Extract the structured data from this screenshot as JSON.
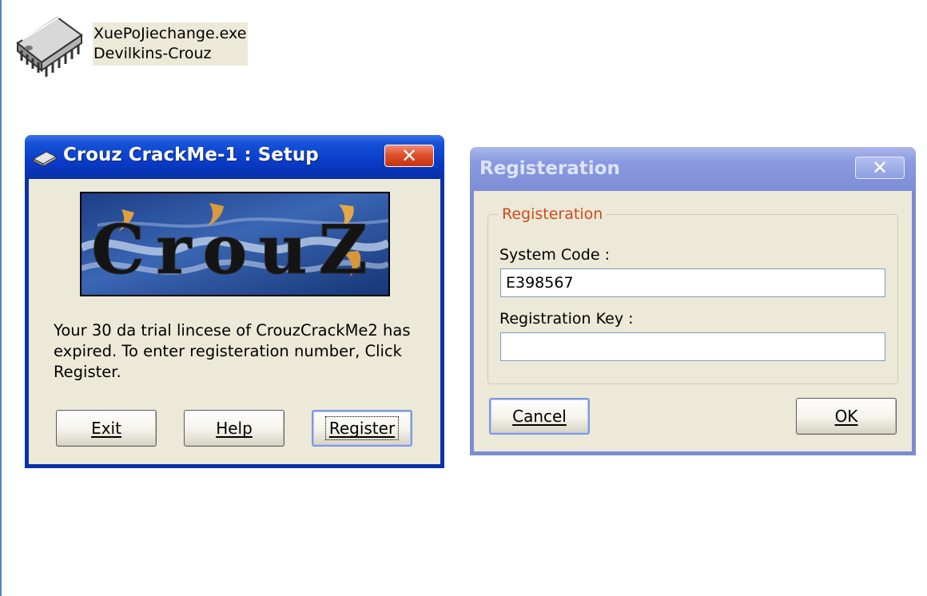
{
  "desktop": {
    "file_icon": {
      "icon": "chip-icon",
      "filename": "XuePoJiechange.exe",
      "description": "Devilkins-Crouz"
    }
  },
  "setup_dialog": {
    "title": "Crouz CrackMe-1 : Setup",
    "banner_text": "CrouZ",
    "message": "Your 30 da trial lincese of CrouzCrackMe2 has expired. To enter registeration number, Click Register.",
    "buttons": {
      "exit": "Exit",
      "help": "Help",
      "register": "Register"
    }
  },
  "registration_dialog": {
    "title": "Registeration",
    "group_label": "Registeration",
    "system_code_label": "System Code :",
    "system_code_value": "E398567",
    "registration_key_label": "Registration Key :",
    "registration_key_value": "",
    "buttons": {
      "cancel": "Cancel",
      "ok": "OK"
    }
  },
  "colors": {
    "active_titlebar": "#0a3cc8",
    "inactive_titlebar": "#8a9ae0",
    "dialog_face": "#ece9d8",
    "group_label": "#d04a1a",
    "close_button": "#e0502c"
  }
}
